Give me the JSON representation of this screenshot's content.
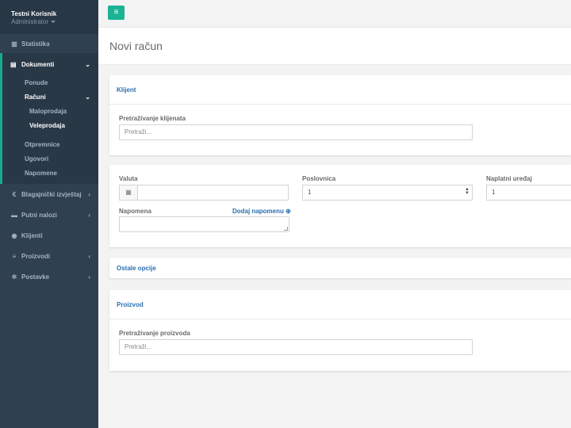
{
  "profile": {
    "name": "Testni Korisnik",
    "role": "Administrator"
  },
  "nav": {
    "statistika": "Statistika",
    "dokumenti": "Dokumenti",
    "ponude": "Ponude",
    "racuni": "Računi",
    "maloprodaja": "Maloprodaja",
    "veleprodaja": "Veleprodaja",
    "otpremnice": "Otpremnice",
    "ugovori": "Ugovori",
    "napomene": "Napomene",
    "blagajnicki": "Blagajnički izvještaj",
    "putni": "Putni nalozi",
    "klijenti": "Klijenti",
    "proizvodi": "Proizvodi",
    "postavke": "Postavke"
  },
  "page_title": "Novi račun",
  "klijent": {
    "title": "Klijent",
    "search_label": "Pretraživanje klijenata",
    "search_placeholder": "Pretraži..."
  },
  "details": {
    "valuta_label": "Valuta",
    "valuta_value": "",
    "poslovnica_label": "Poslovnica",
    "poslovnica_value": "1",
    "uredaj_label": "Naplatni uređaj",
    "uredaj_value": "1",
    "napomena_label": "Napomena",
    "dodaj_napomenu": "Dodaj napomenu"
  },
  "ostale_opcije": "Ostale opcije",
  "proizvod": {
    "title": "Proizvod",
    "search_label": "Pretraživanje proizvoda",
    "search_placeholder": "Pretraži..."
  },
  "colors": {
    "accent": "#1ab394",
    "sidebar": "#2f4050",
    "link": "#2a6fb0"
  }
}
